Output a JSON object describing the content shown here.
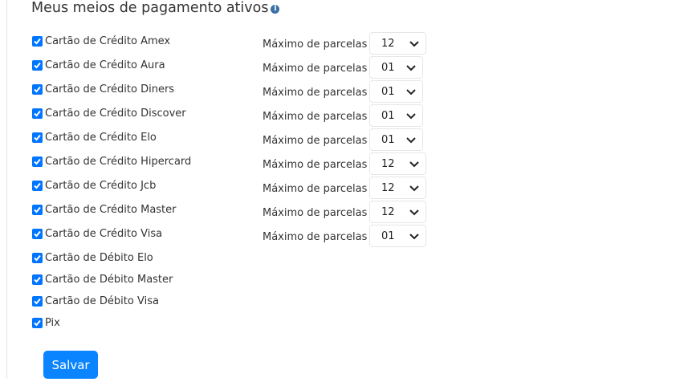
{
  "title": "Meus meios de pagamento ativos",
  "parcelas_label": "Máximo de parcelas",
  "methods": [
    {
      "label": "Cartão de Crédito Amex",
      "checked": true,
      "max_parcelas": "12"
    },
    {
      "label": "Cartão de Crédito Aura",
      "checked": true,
      "max_parcelas": "01"
    },
    {
      "label": "Cartão de Crédito Diners",
      "checked": true,
      "max_parcelas": "01"
    },
    {
      "label": "Cartão de Crédito Discover",
      "checked": true,
      "max_parcelas": "01"
    },
    {
      "label": "Cartão de Crédito Elo",
      "checked": true,
      "max_parcelas": "01"
    },
    {
      "label": "Cartão de Crédito Hipercard",
      "checked": true,
      "max_parcelas": "12"
    },
    {
      "label": "Cartão de Crédito Jcb",
      "checked": true,
      "max_parcelas": "12"
    },
    {
      "label": "Cartão de Crédito Master",
      "checked": true,
      "max_parcelas": "12"
    },
    {
      "label": "Cartão de Crédito Visa",
      "checked": true,
      "max_parcelas": "01"
    },
    {
      "label": "Cartão de Débito Elo",
      "checked": true
    },
    {
      "label": "Cartão de Débito Master",
      "checked": true
    },
    {
      "label": "Cartão de Débito Visa",
      "checked": true
    },
    {
      "label": "Pix",
      "checked": true
    }
  ],
  "save_label": "Salvar",
  "colors": {
    "accent": "#0a84ff",
    "checkbox": "#0075ff",
    "info_icon": "#3a6fa8"
  }
}
